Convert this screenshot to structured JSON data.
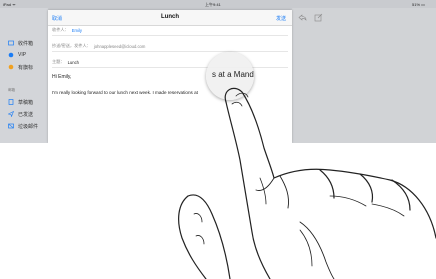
{
  "status": {
    "carrier": "iPad ᯤ",
    "time": "上午9:41",
    "battery": "51% ▭"
  },
  "sidebar": {
    "items": [
      {
        "label": "收件箱",
        "icon": "inbox-icon"
      },
      {
        "label": "VIP",
        "icon": "star-icon"
      },
      {
        "label": "有旗标",
        "icon": "flag-icon"
      }
    ],
    "section": "邮箱",
    "mailboxes": [
      {
        "label": "草稿箱",
        "icon": "draft-icon"
      },
      {
        "label": "已发送",
        "icon": "sent-icon"
      },
      {
        "label": "垃圾邮件",
        "icon": "junk-icon"
      }
    ]
  },
  "compose": {
    "cancel": "取消",
    "title": "Lunch",
    "send": "发送",
    "to_label": "收件人：",
    "to_value": "Emily",
    "cc_label": "抄送/密送，发件人：",
    "cc_value": "johnappleseed@icloud.com",
    "subject_label": "主题：",
    "subject_value": "Lunch",
    "greeting": "Hi Emily,",
    "body": "I'm really looking forward to our lunch next week. I made reservations at"
  },
  "magnifier": {
    "text": "s at a Manda"
  },
  "colors": {
    "accent": "#1a7cf5"
  }
}
